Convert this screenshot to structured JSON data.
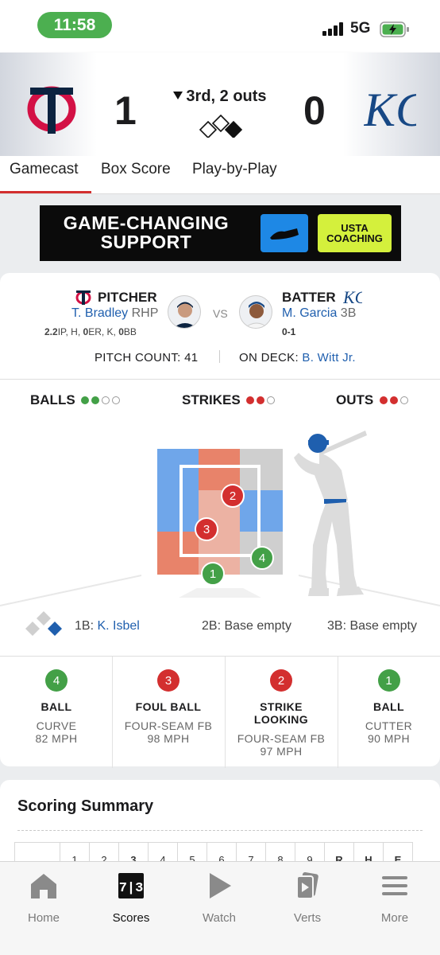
{
  "status": {
    "time": "11:58",
    "network": "5G"
  },
  "header": {
    "away_team": "Twins",
    "away_score": "1",
    "home_team": "Royals",
    "home_score": "0",
    "inning_text": "3rd, 2 outs"
  },
  "tabs": [
    "Gamecast",
    "Box Score",
    "Play-by-Play"
  ],
  "ad": {
    "headline_line1": "GAME-CHANGING",
    "headline_line2": "SUPPORT",
    "badge_line1": "USTA",
    "badge_line2": "COACHING"
  },
  "matchup": {
    "pitcher_label": "PITCHER",
    "pitcher_name": "T. Bradley",
    "pitcher_pos": "RHP",
    "pitcher_line": {
      "ip": "2.2",
      "ip_label": "IP, ",
      "h_label": "H, ",
      "er": "0",
      "er_label": "ER, ",
      "k_label": "K, ",
      "bb": "0",
      "bb_label": "BB"
    },
    "vs": "VS",
    "batter_label": "BATTER",
    "batter_name": "M. Garcia",
    "batter_pos": "3B",
    "batter_line": "0-1",
    "pitch_count_label": "PITCH COUNT: ",
    "pitch_count": "41",
    "on_deck_label": "ON DECK: ",
    "on_deck": "B. Witt Jr."
  },
  "count": {
    "balls_label": "BALLS",
    "balls": 2,
    "strikes_label": "STRIKES",
    "strikes": 2,
    "outs_label": "OUTS",
    "outs": 2
  },
  "pitches": [
    {
      "num": "4",
      "result": "BALL",
      "type": "CURVE",
      "speed": "82 MPH",
      "color": "#43a047"
    },
    {
      "num": "3",
      "result": "FOUL BALL",
      "type": "FOUR-SEAM FB",
      "speed": "98 MPH",
      "color": "#d32f2f"
    },
    {
      "num": "2",
      "result": "STRIKE LOOKING",
      "type": "FOUR-SEAM FB",
      "speed": "97 MPH",
      "color": "#d32f2f"
    },
    {
      "num": "1",
      "result": "BALL",
      "type": "CUTTER",
      "speed": "90 MPH",
      "color": "#43a047"
    }
  ],
  "strike_zone_pitches": [
    "2",
    "3",
    "4",
    "1"
  ],
  "bases": {
    "first_label": "1B: ",
    "first": "K. Isbel",
    "second": "2B: Base empty",
    "third": "3B: Base empty"
  },
  "scoring": {
    "title": "Scoring Summary",
    "columns": [
      "",
      "1",
      "2",
      "3",
      "4",
      "5",
      "6",
      "7",
      "8",
      "9",
      "R",
      "H",
      "E"
    ]
  },
  "tabbar": {
    "items": [
      "Home",
      "Scores",
      "Watch",
      "Verts",
      "More"
    ],
    "active": "Scores",
    "scores_icon_text": "7|3"
  },
  "colors": {
    "accent_red": "#d32f2f",
    "ball_green": "#43a047",
    "link_blue": "#1f5fae",
    "twins_navy": "#0c2340",
    "royals_blue": "#174885"
  }
}
